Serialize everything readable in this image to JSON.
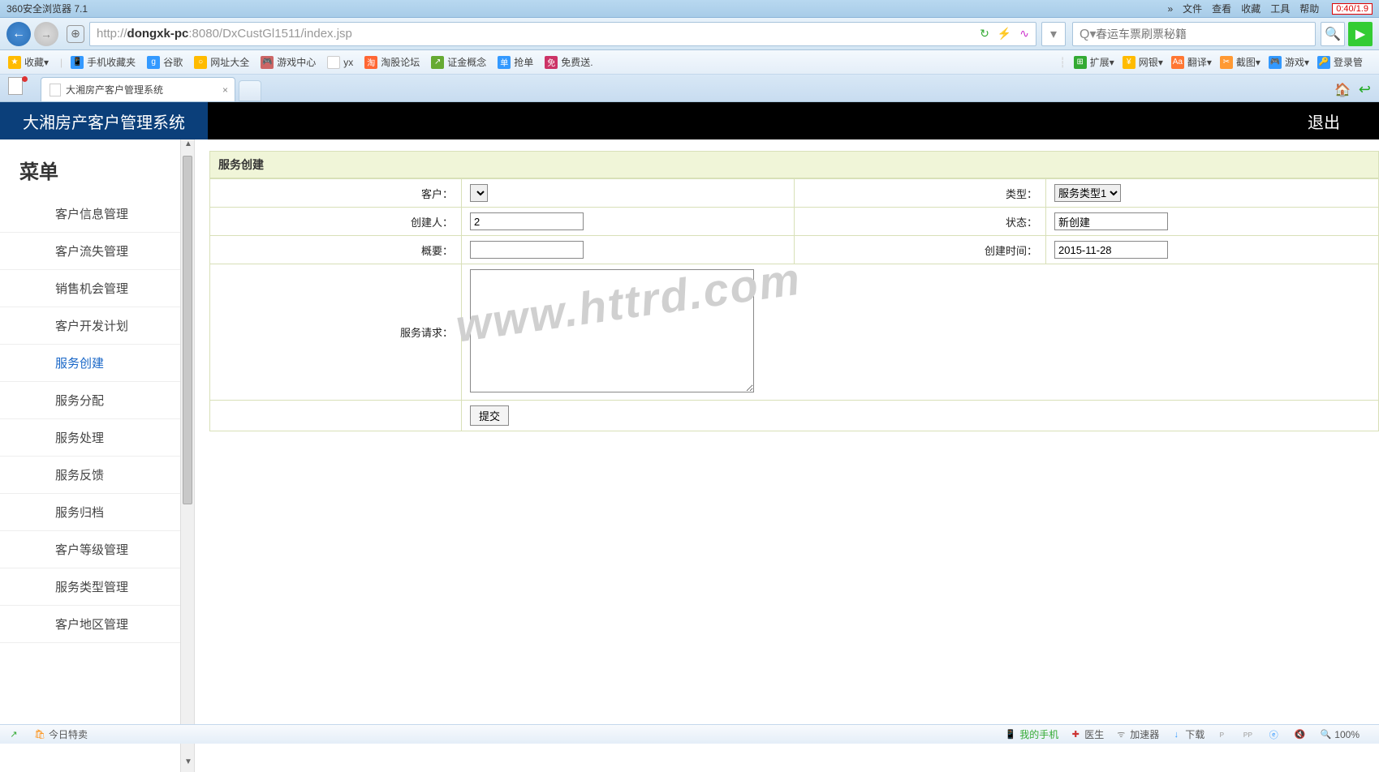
{
  "browser": {
    "title": "360安全浏览器 7.1",
    "menus": [
      "文件",
      "查看",
      "收藏",
      "工具",
      "帮助"
    ],
    "warn": "0:40/1.9",
    "url_proto": "http://",
    "url_host": "dongxk-pc",
    "url_path": ":8080/DxCustGl1511/index.jsp",
    "search_placeholder": "春运车票刷票秘籍"
  },
  "bookmarks": {
    "fav": "收藏",
    "items": [
      "手机收藏夹",
      "谷歌",
      "网址大全",
      "游戏中心",
      "yx",
      "淘股论坛",
      "证金概念",
      "抢单",
      "免费送."
    ],
    "right": [
      "扩展",
      "网银",
      "翻译",
      "截图",
      "游戏",
      "登录管"
    ]
  },
  "tab": {
    "title": "大湘房产客户管理系统"
  },
  "page": {
    "brand": "大湘房产客户管理系统",
    "logout": "退出",
    "menu_title": "菜单",
    "menu_items": [
      "客户信息管理",
      "客户流失管理",
      "销售机会管理",
      "客户开发计划",
      "服务创建",
      "服务分配",
      "服务处理",
      "服务反馈",
      "服务归档",
      "客户等级管理",
      "服务类型管理",
      "客户地区管理"
    ],
    "menu_active_index": 4,
    "panel_title": "服务创建",
    "form": {
      "customer_label": "客户：",
      "type_label": "类型：",
      "type_value": "服务类型1",
      "creator_label": "创建人：",
      "creator_value": "2",
      "status_label": "状态：",
      "status_value": "新创建",
      "summary_label": "概要：",
      "summary_value": "",
      "created_label": "创建时间：",
      "created_value": "2015-11-28",
      "request_label": "服务请求：",
      "submit": "提交"
    },
    "watermark": "www.httrd.com"
  },
  "status": {
    "left": [
      "今日特卖"
    ],
    "right": [
      "我的手机",
      "医生",
      "加速器",
      "下载",
      "e",
      "100%"
    ]
  }
}
